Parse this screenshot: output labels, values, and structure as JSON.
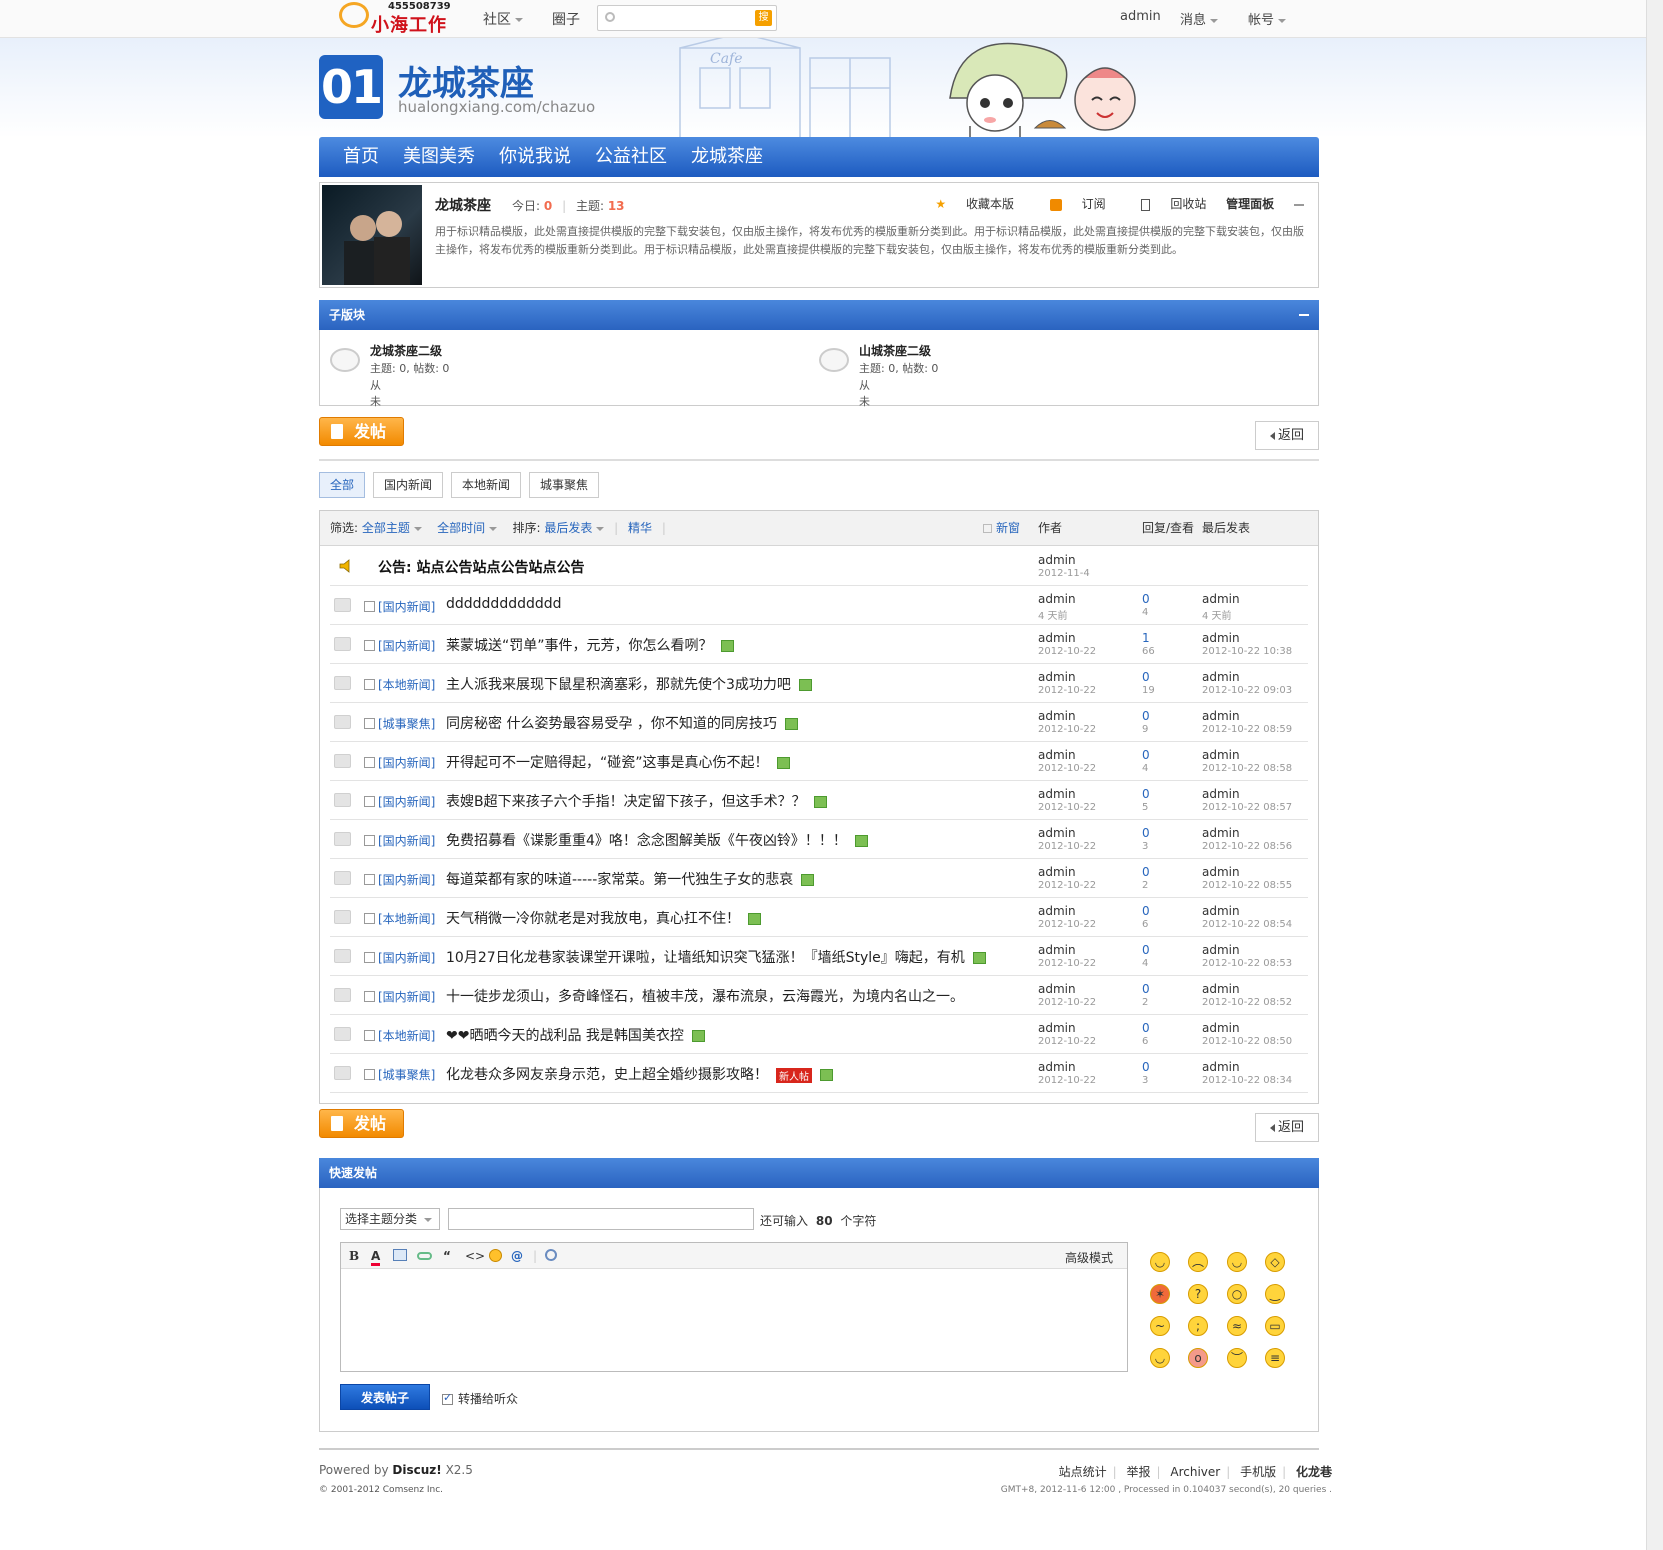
{
  "topbar": {
    "logo_number": "455508739",
    "logo_brand": "小海工作室",
    "nav_community": "社区",
    "nav_circle": "圈子",
    "search_placeholder": "",
    "search_button": "搜",
    "user": "admin",
    "messages": "消息",
    "account": "帐号"
  },
  "header": {
    "number": "01",
    "site_name": "龙城茶座",
    "site_url": "hualongxiang.com/chazuo"
  },
  "mainnav": [
    "首页",
    "美图美秀",
    "你说我说",
    "公益社区",
    "龙城茶座"
  ],
  "forum": {
    "name": "龙城茶座",
    "today_label": "今日:",
    "today_value": "0",
    "topics_label": "主题:",
    "topics_value": "13",
    "actions": [
      "收藏本版",
      "订阅",
      "回收站",
      "管理面板"
    ],
    "description": "用于标识精品模版，此处需直接提供模版的完整下载安装包，仅由版主操作，将发布优秀的模版重新分类到此。用于标识精品模版，此处需直接提供模版的完整下载安装包，仅由版主操作，将发布优秀的模版重新分类到此。用于标识精品模版，此处需直接提供模版的完整下载安装包，仅由版主操作，将发布优秀的模版重新分类到此。"
  },
  "subforums": {
    "title": "子版块",
    "items": [
      {
        "name": "龙城茶座二级",
        "stats": "主题: 0, 帖数: 0",
        "last": "从未"
      },
      {
        "name": "山城茶座二级",
        "stats": "主题: 0, 帖数: 0",
        "last": "从未"
      }
    ]
  },
  "buttons": {
    "post": "发帖",
    "back": "返回"
  },
  "tabs": [
    "全部",
    "国内新闻",
    "本地新闻",
    "城事聚焦"
  ],
  "listhead": {
    "filter_label": "筛选:",
    "all_topics": "全部主题",
    "all_time": "全部时间",
    "sort_label": "排序:",
    "latest": "最后发表",
    "digest": "精华",
    "new_window": "新窗",
    "author": "作者",
    "replies_views": "回复/查看",
    "last_post": "最后发表"
  },
  "announcement": {
    "title": "公告: 站点公告站点公告站点公告",
    "author": "admin",
    "date": "2012-11-4"
  },
  "threads": [
    {
      "cat": "[国内新闻]",
      "title": "ddddddddddddd",
      "img": false,
      "newbie": false,
      "author": "admin",
      "adate": "4 天前",
      "replies": "0",
      "views": "4",
      "last_user": "admin",
      "last_date": "4 天前"
    },
    {
      "cat": "[国内新闻]",
      "title": "莱蒙城送“罚单”事件，元芳，你怎么看咧？",
      "img": true,
      "newbie": false,
      "author": "admin",
      "adate": "2012-10-22",
      "replies": "1",
      "views": "66",
      "last_user": "admin",
      "last_date": "2012-10-22 10:38"
    },
    {
      "cat": "[本地新闻]",
      "title": "主人派我来展现下鼠星积滴塞彩，那就先使个3成功力吧",
      "img": true,
      "newbie": false,
      "author": "admin",
      "adate": "2012-10-22",
      "replies": "0",
      "views": "19",
      "last_user": "admin",
      "last_date": "2012-10-22 09:03"
    },
    {
      "cat": "[城事聚焦]",
      "title": "同房秘密 什么姿势最容易受孕 ，你不知道的同房技巧",
      "img": true,
      "newbie": false,
      "author": "admin",
      "adate": "2012-10-22",
      "replies": "0",
      "views": "9",
      "last_user": "admin",
      "last_date": "2012-10-22 08:59"
    },
    {
      "cat": "[国内新闻]",
      "title": "开得起可不一定赔得起，“碰瓷”这事是真心伤不起！",
      "img": true,
      "newbie": false,
      "author": "admin",
      "adate": "2012-10-22",
      "replies": "0",
      "views": "4",
      "last_user": "admin",
      "last_date": "2012-10-22 08:58"
    },
    {
      "cat": "[国内新闻]",
      "title": "表嫂B超下来孩子六个手指！决定留下孩子，但这手术？？",
      "img": true,
      "newbie": false,
      "author": "admin",
      "adate": "2012-10-22",
      "replies": "0",
      "views": "5",
      "last_user": "admin",
      "last_date": "2012-10-22 08:57"
    },
    {
      "cat": "[国内新闻]",
      "title": "免费招募看《谍影重重4》咯！念念图解美版《午夜凶铃》！！！",
      "img": true,
      "newbie": false,
      "author": "admin",
      "adate": "2012-10-22",
      "replies": "0",
      "views": "3",
      "last_user": "admin",
      "last_date": "2012-10-22 08:56"
    },
    {
      "cat": "[国内新闻]",
      "title": "每道菜都有家的味道-----家常菜。第一代独生子女的悲哀",
      "img": true,
      "newbie": false,
      "author": "admin",
      "adate": "2012-10-22",
      "replies": "0",
      "views": "2",
      "last_user": "admin",
      "last_date": "2012-10-22 08:55"
    },
    {
      "cat": "[本地新闻]",
      "title": "天气稍微一冷你就老是对我放电，真心扛不住！",
      "img": true,
      "newbie": false,
      "author": "admin",
      "adate": "2012-10-22",
      "replies": "0",
      "views": "6",
      "last_user": "admin",
      "last_date": "2012-10-22 08:54"
    },
    {
      "cat": "[国内新闻]",
      "title": "10月27日化龙巷家装课堂开课啦，让墙纸知识突飞猛涨！『墙纸Style』嗨起，有机",
      "img": true,
      "newbie": false,
      "author": "admin",
      "adate": "2012-10-22",
      "replies": "0",
      "views": "4",
      "last_user": "admin",
      "last_date": "2012-10-22 08:53"
    },
    {
      "cat": "[国内新闻]",
      "title": "十一徒步龙须山，多奇峰怪石，植被丰茂，瀑布流泉，云海霞光，为境内名山之一。",
      "img": false,
      "newbie": false,
      "author": "admin",
      "adate": "2012-10-22",
      "replies": "0",
      "views": "2",
      "last_user": "admin",
      "last_date": "2012-10-22 08:52"
    },
    {
      "cat": "[本地新闻]",
      "title": "❤❤晒晒今天的战利品 我是韩国美衣控",
      "img": true,
      "newbie": false,
      "author": "admin",
      "adate": "2012-10-22",
      "replies": "0",
      "views": "6",
      "last_user": "admin",
      "last_date": "2012-10-22 08:50"
    },
    {
      "cat": "[城事聚焦]",
      "title": "化龙巷众多网友亲身示范，史上超全婚纱摄影攻略！",
      "img": true,
      "newbie": true,
      "author": "admin",
      "adate": "2012-10-22",
      "replies": "0",
      "views": "3",
      "last_user": "admin",
      "last_date": "2012-10-22 08:34"
    }
  ],
  "newbie_label": "新人帖",
  "quickpost": {
    "title": "快速发帖",
    "select_category": "选择主题分类",
    "limit_prefix": "还可输入",
    "limit_value": "80",
    "limit_suffix": "个字符",
    "advanced": "高级模式",
    "submit": "发表帖子",
    "broadcast": "转播给听众"
  },
  "footer": {
    "powered_prefix": "Powered by",
    "powered_brand": "Discuz!",
    "powered_version": "X2.5",
    "copyright": "© 2001-2012 Comsenz Inc.",
    "links": [
      "站点统计",
      "举报",
      "Archiver",
      "手机版",
      "化龙巷"
    ],
    "gmt": "GMT+8, 2012-11-6 12:00 , Processed in 0.104037 second(s), 20 queries ."
  },
  "colors": {
    "brand_blue": "#1f62c2",
    "link_blue": "#2866bd",
    "orange": "#f28a00",
    "count_red": "#f26c4f"
  }
}
